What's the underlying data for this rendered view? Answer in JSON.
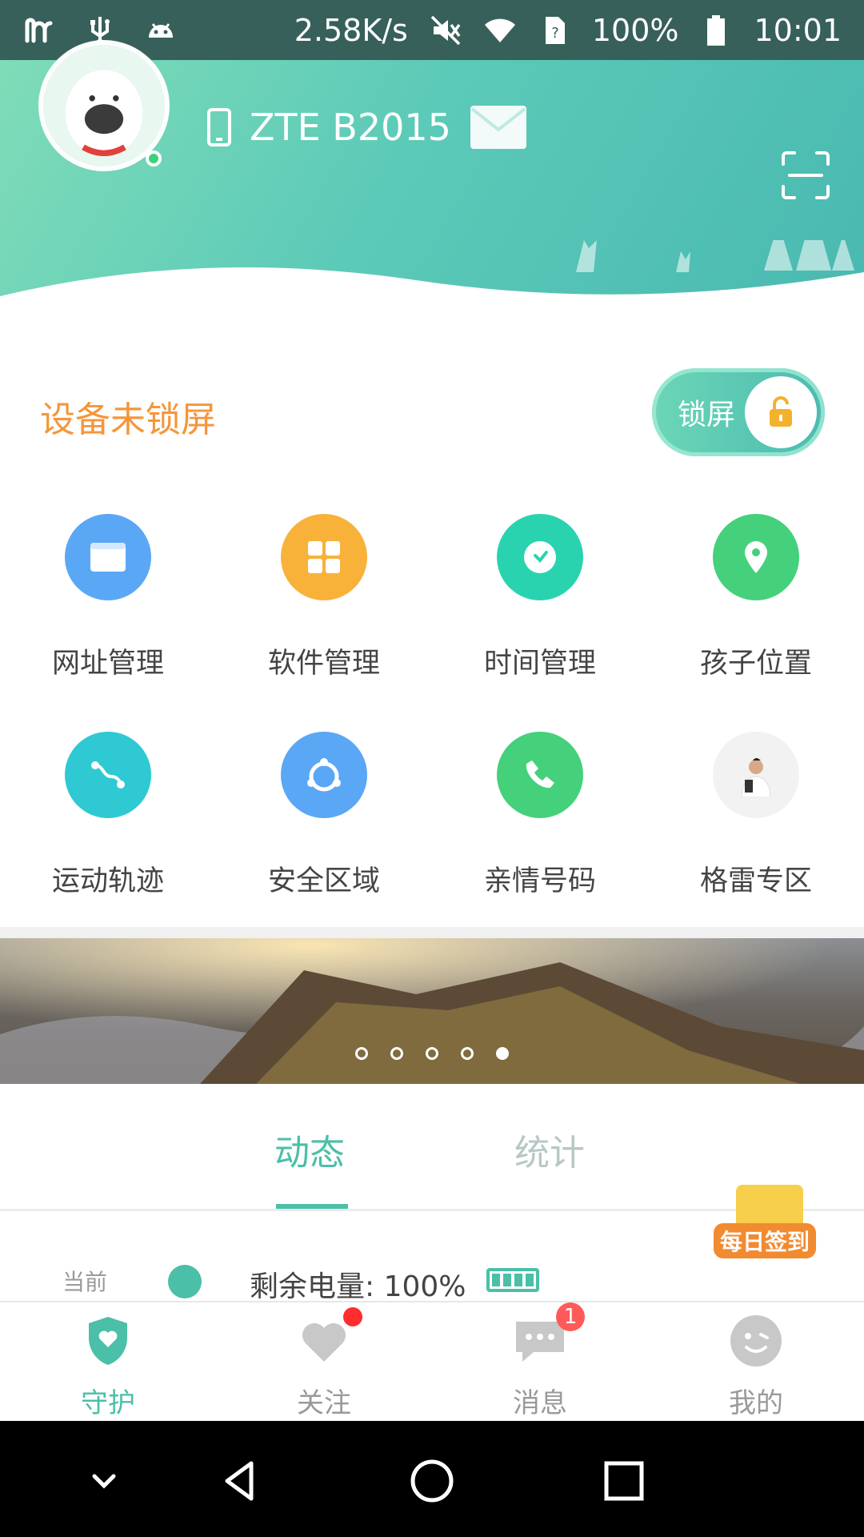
{
  "status_bar": {
    "network_speed": "2.58K/s",
    "battery_percent": "100%",
    "time": "10:01",
    "icons": [
      "m-app-icon",
      "usb-icon",
      "android-icon",
      "mute-icon",
      "wifi-icon",
      "sim-unknown-icon",
      "battery-icon"
    ]
  },
  "header": {
    "device_name": "ZTE B2015",
    "avatar_icon": "avatar-dog",
    "scan_icon": "scan-icon",
    "mail_icon": "mail-icon",
    "phone_icon": "phone-icon"
  },
  "lock": {
    "status_text": "设备未锁屏",
    "toggle_label": "锁屏"
  },
  "grid": [
    {
      "label": "网址管理",
      "icon": "browser-icon",
      "color": "#5aa7f5"
    },
    {
      "label": "软件管理",
      "icon": "apps-icon",
      "color": "#f8b23a"
    },
    {
      "label": "时间管理",
      "icon": "clock-icon",
      "color": "#2ad3b0"
    },
    {
      "label": "孩子位置",
      "icon": "location-icon",
      "color": "#45d07b"
    },
    {
      "label": "运动轨迹",
      "icon": "route-icon",
      "color": "#2fc9d4"
    },
    {
      "label": "安全区域",
      "icon": "safe-zone-icon",
      "color": "#5aa7f5"
    },
    {
      "label": "亲情号码",
      "icon": "phone-call-icon",
      "color": "#45d07b"
    },
    {
      "label": "格雷专区",
      "icon": "promo-person-icon",
      "color": "#f2f2f2"
    }
  ],
  "banner": {
    "page_count": 5,
    "active_index": 4
  },
  "tabs": {
    "active": "动态",
    "inactive": "统计"
  },
  "checkin": {
    "label": "每日签到"
  },
  "feed": {
    "when": "当前",
    "text": "剩余电量: 100%"
  },
  "bottom_nav": [
    {
      "label": "守护",
      "icon": "shield-heart-icon",
      "active": true
    },
    {
      "label": "关注",
      "icon": "heart-icon",
      "badge_dot": true
    },
    {
      "label": "消息",
      "icon": "chat-icon",
      "badge_count": "1"
    },
    {
      "label": "我的",
      "icon": "face-icon"
    }
  ],
  "colors": {
    "accent": "#4bbfa8",
    "orange": "#f5963a",
    "status_bar": "#38605a"
  }
}
